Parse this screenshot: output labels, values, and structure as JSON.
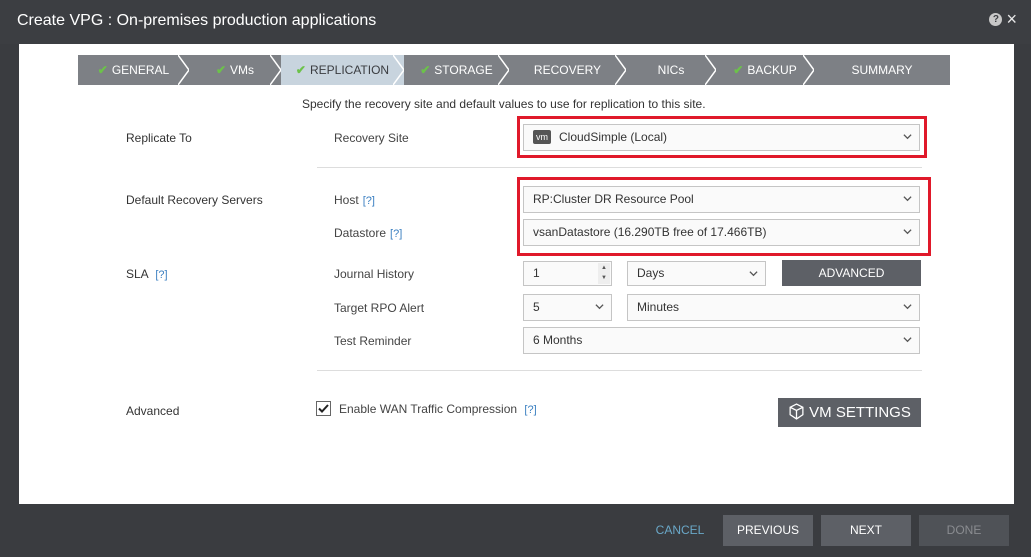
{
  "window": {
    "title": "Create VPG : On-premises production applications",
    "help_icon": "?",
    "close_icon": "×"
  },
  "steps": [
    {
      "label": "GENERAL",
      "done": true
    },
    {
      "label": "VMs",
      "done": true
    },
    {
      "label": "REPLICATION",
      "done": true,
      "active": true
    },
    {
      "label": "STORAGE",
      "done": true
    },
    {
      "label": "RECOVERY",
      "done": false
    },
    {
      "label": "NICs",
      "done": false
    },
    {
      "label": "BACKUP",
      "done": true
    },
    {
      "label": "SUMMARY",
      "done": false
    }
  ],
  "intro": "Specify the recovery site and default values to use for replication to this site.",
  "replicate_to": {
    "section_label": "Replicate To",
    "recovery_site_label": "Recovery Site",
    "recovery_site_badge": "vm",
    "recovery_site_value": "CloudSimple (Local)"
  },
  "default_servers": {
    "section_label": "Default Recovery Servers",
    "host_label": "Host",
    "host_help": "[?]",
    "host_value": "RP:Cluster DR Resource Pool",
    "datastore_label": "Datastore",
    "datastore_help": "[?]",
    "datastore_value": "vsanDatastore (16.290TB free of 17.466TB)"
  },
  "sla": {
    "section_label": "SLA",
    "section_help": "[?]",
    "journal_history_label": "Journal History",
    "journal_history_value": "1",
    "journal_history_unit": "Days",
    "advanced_button": "ADVANCED",
    "target_rpo_label": "Target RPO Alert",
    "target_rpo_value": "5",
    "target_rpo_unit": "Minutes",
    "test_reminder_label": "Test Reminder",
    "test_reminder_value": "6 Months"
  },
  "advanced": {
    "section_label": "Advanced",
    "wan_compression_label": "Enable WAN Traffic Compression",
    "wan_compression_checked": true,
    "wan_compression_help": "[?]",
    "vm_settings_button": "VM SETTINGS"
  },
  "footer": {
    "cancel": "CANCEL",
    "previous": "PREVIOUS",
    "next": "NEXT",
    "done": "DONE"
  },
  "colors": {
    "highlight_red": "#e0192a",
    "check_green": "#6cc24a",
    "active_step": "#c8d4de",
    "link_blue": "#3a7fc1"
  }
}
